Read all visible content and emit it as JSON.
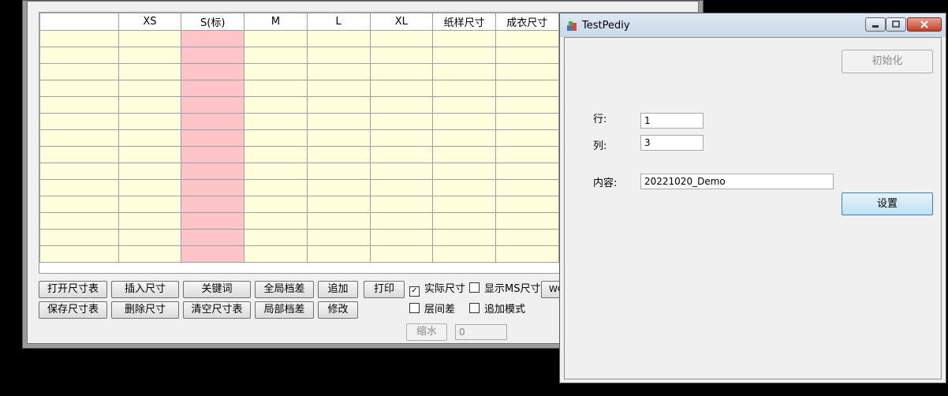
{
  "back_window": {
    "grid": {
      "columns": [
        "",
        "XS",
        "S(标)",
        "M",
        "L",
        "XL",
        "纸样尺寸",
        "成衣尺寸"
      ],
      "row_count": 14
    },
    "buttons": {
      "open_size_table": "打开尺寸表",
      "insert_size": "插入尺寸",
      "keyword": "关键词",
      "global_grade": "全局档差",
      "append": "追加",
      "print": "打印",
      "save_size_table": "保存尺寸表",
      "delete_size": "删除尺寸",
      "clear_size_table": "清空尺寸表",
      "local_grade": "局部档差",
      "modify": "修改",
      "partial_w": "WO",
      "shrink": "缩水"
    },
    "checkboxes": {
      "actual_size": {
        "label": "实际尺寸",
        "checked": true
      },
      "show_ms_size": {
        "label": "显示MS尺寸",
        "checked": false
      },
      "layer_diff": {
        "label": "层间差",
        "checked": false
      },
      "append_mode": {
        "label": "追加模式",
        "checked": false
      }
    },
    "shrink_value": "0"
  },
  "front_window": {
    "title": "TestPediy",
    "init_button": "初始化",
    "row_label": "行:",
    "row_value": "1",
    "col_label": "列:",
    "col_value": "3",
    "content_label": "内容:",
    "content_value": "20221020_Demo",
    "set_button": "设置"
  }
}
